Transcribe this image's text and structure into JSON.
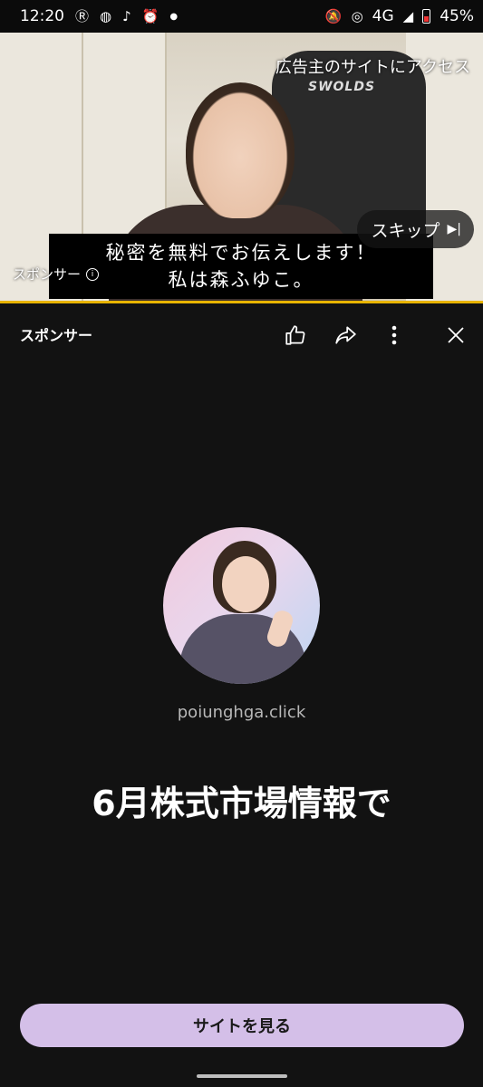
{
  "status_bar": {
    "time": "12:20",
    "left_icons": [
      "rakuten-icon",
      "line-icon",
      "tiktok-icon",
      "alarm-icon",
      "dot-icon"
    ],
    "network": "4G",
    "battery": "45%"
  },
  "video": {
    "top_link": "広告主のサイトにアクセス",
    "skip_label": "スキップ",
    "caption_line1": "秘密を無料でお伝えします！",
    "caption_line2": "私は森ふゆこ。",
    "sponsor_label": "スポンサー",
    "chair_brand": "SWOLDS"
  },
  "action_bar": {
    "title": "スポンサー",
    "icons": [
      "thumbs-up-icon",
      "share-icon",
      "more-vert-icon",
      "close-icon"
    ]
  },
  "ad": {
    "domain": "poiunghga.click",
    "headline": "6月株式市場情報で",
    "cta_label": "サイトを見る"
  },
  "colors": {
    "background": "#121212",
    "progress": "#e8b400",
    "cta": "#d4bfe8"
  }
}
